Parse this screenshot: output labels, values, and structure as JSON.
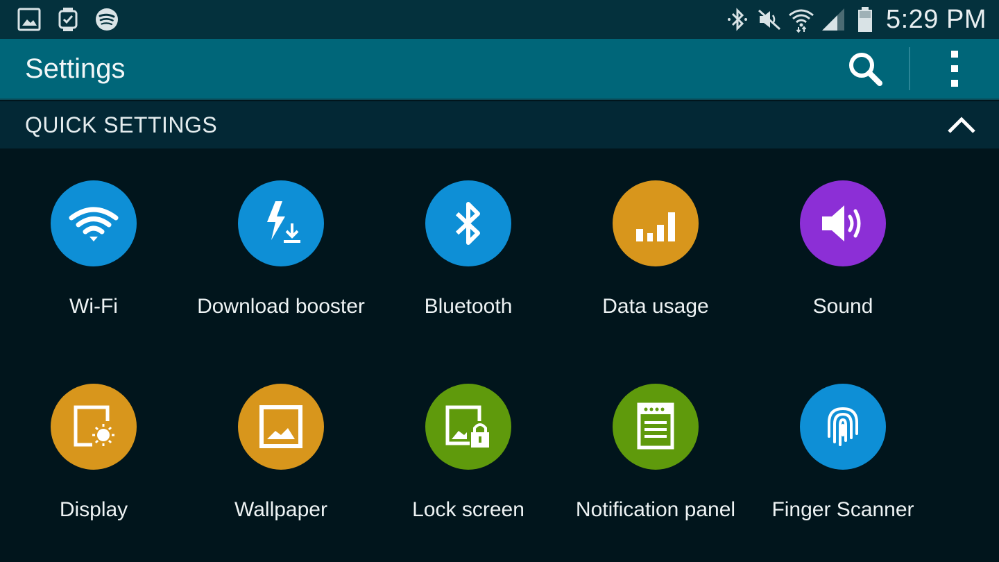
{
  "status_bar": {
    "left_icons": [
      "gallery-icon",
      "watch-icon",
      "spotify-icon"
    ],
    "right_icons": [
      "bluetooth-icon",
      "mute-icon",
      "wifi-icon",
      "signal-icon",
      "battery-icon"
    ],
    "time": "5:29 PM"
  },
  "action_bar": {
    "title": "Settings",
    "search_icon": "search-icon",
    "more_icon": "more-vertical-icon"
  },
  "section": {
    "title": "QUICK SETTINGS",
    "collapse_icon": "chevron-up-icon"
  },
  "quick_settings": [
    {
      "label": "Wi-Fi",
      "icon": "wifi-icon",
      "color": "#0e8fd6"
    },
    {
      "label": "Download booster",
      "icon": "download-booster-icon",
      "color": "#0e8fd6"
    },
    {
      "label": "Bluetooth",
      "icon": "bluetooth-icon",
      "color": "#0e8fd6"
    },
    {
      "label": "Data usage",
      "icon": "data-usage-icon",
      "color": "#d8961c"
    },
    {
      "label": "Sound",
      "icon": "sound-icon",
      "color": "#8c2fd6"
    },
    {
      "label": "Display",
      "icon": "display-icon",
      "color": "#d8961c"
    },
    {
      "label": "Wallpaper",
      "icon": "wallpaper-icon",
      "color": "#d8961c"
    },
    {
      "label": "Lock screen",
      "icon": "lock-screen-icon",
      "color": "#5f9a0c"
    },
    {
      "label": "Notification panel",
      "icon": "notification-panel-icon",
      "color": "#5f9a0c"
    },
    {
      "label": "Finger Scanner",
      "icon": "fingerprint-icon",
      "color": "#0e8fd6"
    }
  ],
  "colors": {
    "status_bar": "#04313d",
    "action_bar": "#006679",
    "section_header": "#032835",
    "background": "#01151c"
  }
}
